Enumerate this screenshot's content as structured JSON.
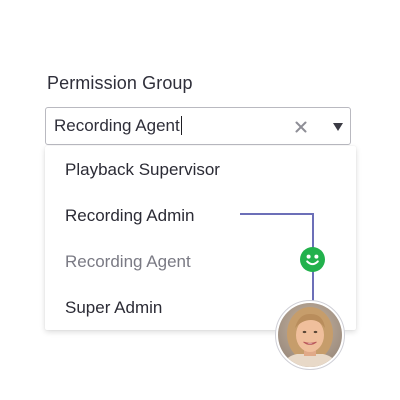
{
  "field": {
    "label": "Permission Group",
    "value": "Recording Agent"
  },
  "icons": {
    "clear": "close-icon",
    "toggle": "chevron-down-icon",
    "reaction": "smiley-face-icon",
    "user": "avatar-photo"
  },
  "dropdown": {
    "options": [
      {
        "label": "Playback Supervisor",
        "selected": false
      },
      {
        "label": "Recording Admin",
        "selected": false
      },
      {
        "label": "Recording Agent",
        "selected": true
      },
      {
        "label": "Super Admin",
        "selected": false
      }
    ]
  },
  "colors": {
    "connector_line": "#6c6fb8",
    "smiley_bg": "#22b14c",
    "selected_text": "#7a7a84",
    "border": "#b9b9c0"
  }
}
